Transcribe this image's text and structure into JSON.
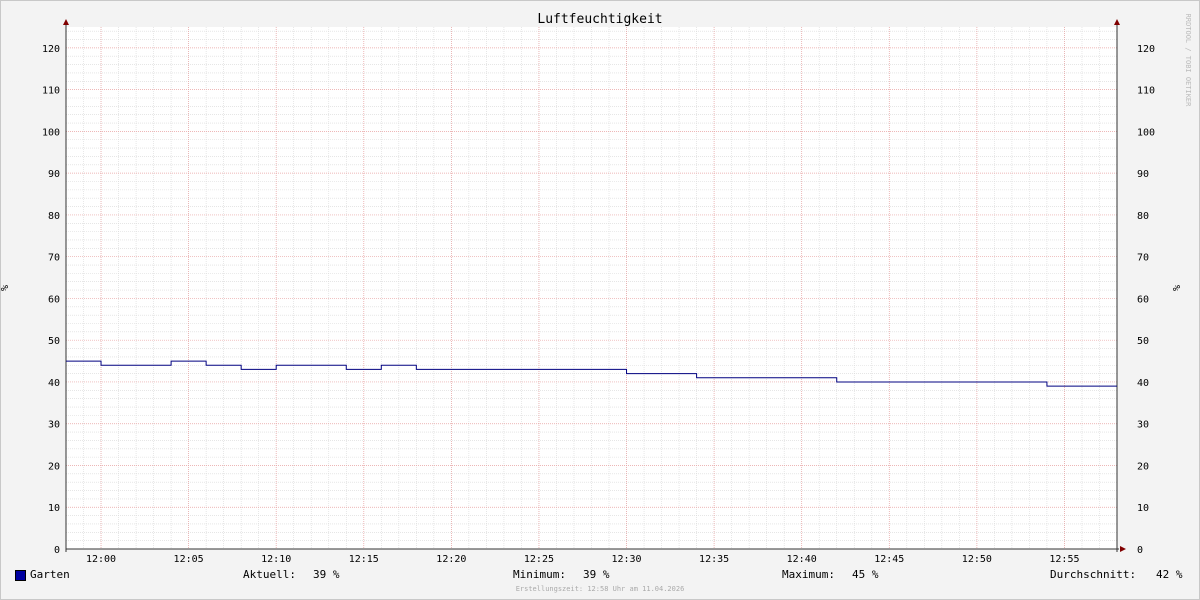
{
  "chart_data": {
    "type": "line",
    "title": "Luftfeuchtigkeit",
    "ylabel": "%",
    "ylim": [
      0,
      125
    ],
    "y_ticks": [
      0,
      10,
      20,
      30,
      40,
      50,
      60,
      70,
      80,
      90,
      100,
      110,
      120
    ],
    "x_range": [
      "11:58",
      "12:58"
    ],
    "x_ticks": [
      "12:00",
      "12:05",
      "12:10",
      "12:15",
      "12:20",
      "12:25",
      "12:30",
      "12:35",
      "12:40",
      "12:45",
      "12:50",
      "12:55"
    ],
    "grid": true,
    "legend_position": "bottom",
    "series": [
      {
        "name": "Garten",
        "color": "#000080",
        "step": true,
        "x": [
          "11:58",
          "12:00",
          "12:04",
          "12:06",
          "12:08",
          "12:10",
          "12:14",
          "12:16",
          "12:18",
          "12:30",
          "12:34",
          "12:42",
          "12:54"
        ],
        "values": [
          45,
          44,
          45,
          44,
          43,
          44,
          43,
          44,
          43,
          42,
          41,
          40,
          39
        ]
      }
    ]
  },
  "legend": {
    "series_name": "Garten",
    "aktuell_label": "Aktuell:",
    "aktuell_value": "39 %",
    "minimum_label": "Minimum:",
    "minimum_value": "39 %",
    "maximum_label": "Maximum:",
    "maximum_value": "45 %",
    "durchschnitt_label": "Durchschnitt:",
    "durchschnitt_value": "42 %"
  },
  "watermark": "RRDTOOL / TOBI OETIKER",
  "footer": "Erstellungszeit: 12:58 Uhr am 11.04.2026",
  "colors": {
    "background": "#f3f3f3",
    "plot_background": "#ffffff",
    "series": "#000080",
    "major_grid": "#e8a0a0",
    "minor_grid": "#d8d8d8",
    "arrows": "#800000"
  }
}
